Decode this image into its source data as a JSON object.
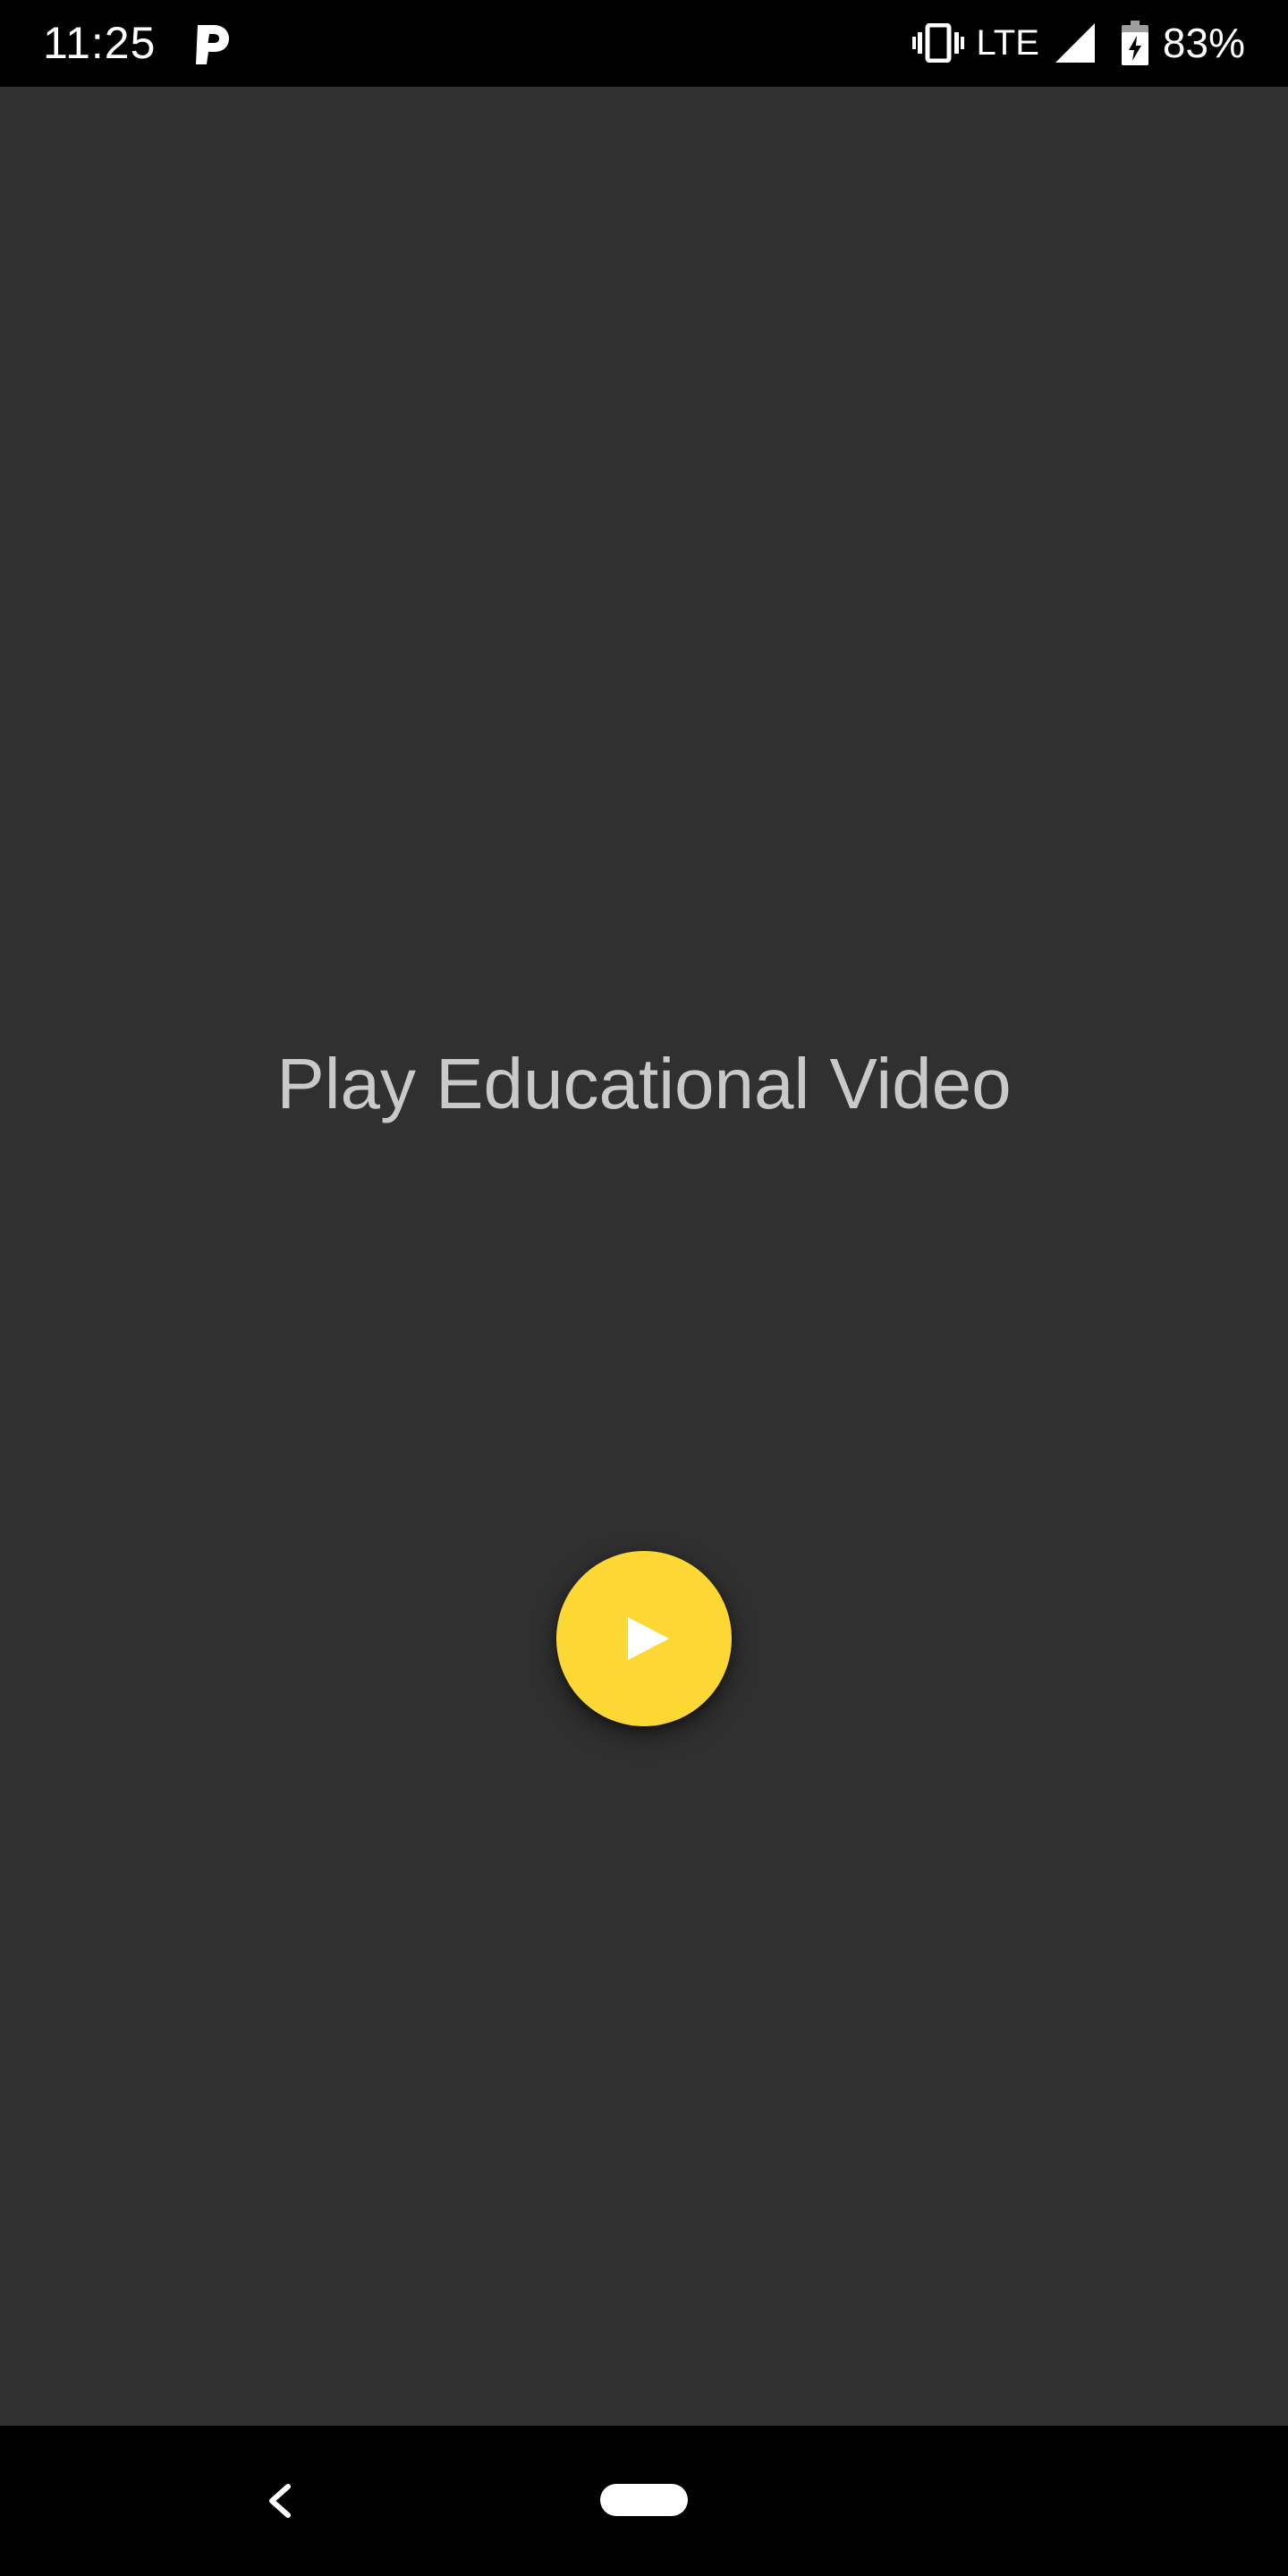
{
  "status_bar": {
    "time": "11:25",
    "notification_icon": "parking-p-icon",
    "vibrate_icon": "vibrate-icon",
    "network": "LTE",
    "signal_icon": "signal-icon",
    "battery_icon": "battery-charging-icon",
    "battery_percent": "83%"
  },
  "main": {
    "title": "Play Educational Video",
    "play_button_icon": "play-icon",
    "accent_color": "#fdd835",
    "background_color": "#303030"
  },
  "nav_bar": {
    "back_icon": "back-chevron-icon",
    "home_icon": "home-pill-icon"
  }
}
